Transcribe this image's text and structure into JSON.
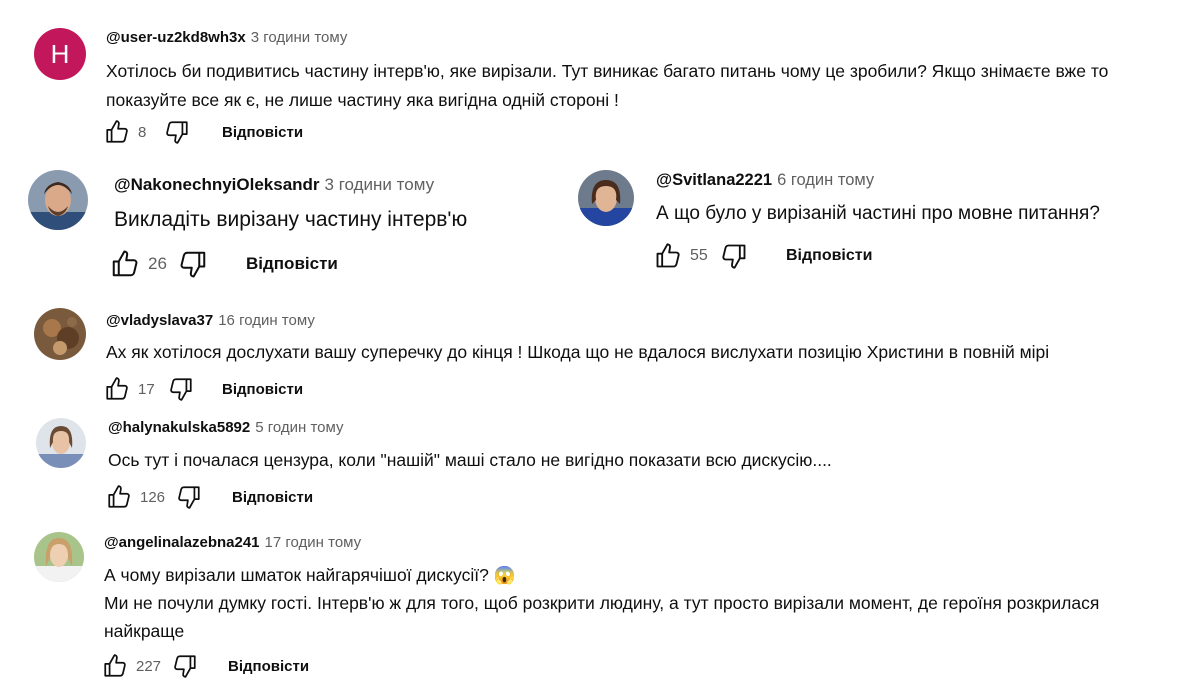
{
  "comments": [
    {
      "avatar_letter": "H",
      "avatar_color": "#c2185b",
      "handle": "@user-uz2kd8wh3x",
      "time": "3 години тому",
      "text_lines": [
        "Хотілось би подивитись частину інтерв'ю, яке вирізали. Тут виникає багато питань чому це зробили? Якщо знімаєте вже то",
        "показуйте все як є, не лише частину яка вигідна одній стороні !"
      ],
      "likes": "8",
      "reply_label": "Відповісти"
    },
    {
      "handle": "@NakonechnyiOleksandr",
      "time": "3 години тому",
      "text_lines": [
        "Викладіть вирізану частину інтерв'ю"
      ],
      "likes": "26",
      "reply_label": "Відповісти"
    },
    {
      "handle": "@Svitlana2221",
      "time": "6 годин тому",
      "text_lines": [
        "А що було у вирізаній частині про мовне питання?"
      ],
      "likes": "55",
      "reply_label": "Відповісти"
    },
    {
      "handle": "@vladyslava37",
      "time": "16 годин тому",
      "text_lines": [
        "Ах як хотілося дослухати вашу суперечку до кінця ! Шкода що не вдалося вислухати позицію Христини в повній мірі"
      ],
      "likes": "17",
      "reply_label": "Відповісти"
    },
    {
      "handle": "@halynakulska5892",
      "time": "5 годин тому",
      "text_lines": [
        "Ось тут і почалася цензура, коли \"нашій\" маші стало не вигідно показати всю дискусію...."
      ],
      "likes": "126",
      "reply_label": "Відповісти"
    },
    {
      "handle": "@angelinalazebna241",
      "time": "17 годин тому",
      "text_lines": [
        "А чому вирізали шматок найгарячішої дискусії? 😱",
        "Ми не почули думку гості. Інтерв'ю ж для того, щоб розкрити людину, а тут просто вирізали момент, де героїня розкрилася",
        "найкраще"
      ],
      "likes": "227",
      "reply_label": "Відповісти"
    }
  ]
}
